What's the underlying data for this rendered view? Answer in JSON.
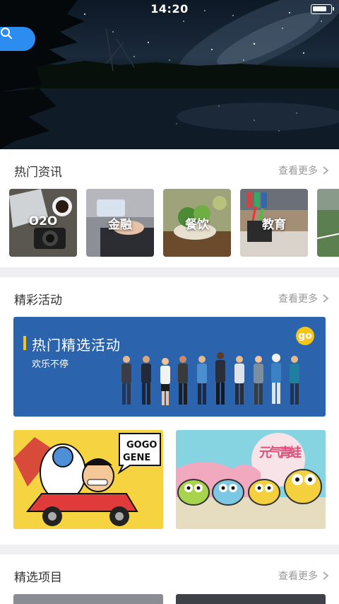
{
  "status_bar": {
    "time": "14:20",
    "battery_level": 0.8
  },
  "hot_news": {
    "title": "热门资讯",
    "more_label": "查看更多",
    "categories": [
      {
        "label": "O2O"
      },
      {
        "label": "金融"
      },
      {
        "label": "餐饮"
      },
      {
        "label": "教育"
      },
      {
        "label": ""
      }
    ]
  },
  "activities": {
    "title": "精彩活动",
    "more_label": "查看更多",
    "banner": {
      "title": "热门精选活动",
      "subtitle": "欢乐不停",
      "badge": "go"
    },
    "tiles": [
      {
        "logo_text_1": "GOGO",
        "logo_text_2": "GENE"
      },
      {
        "logo_text": "元气青蛙"
      }
    ]
  },
  "featured": {
    "title": "精选项目",
    "more_label": "查看更多"
  },
  "colors": {
    "accent": "#2d8cf0",
    "banner_bg": "#2b63ad",
    "highlight": "#f5c518"
  }
}
